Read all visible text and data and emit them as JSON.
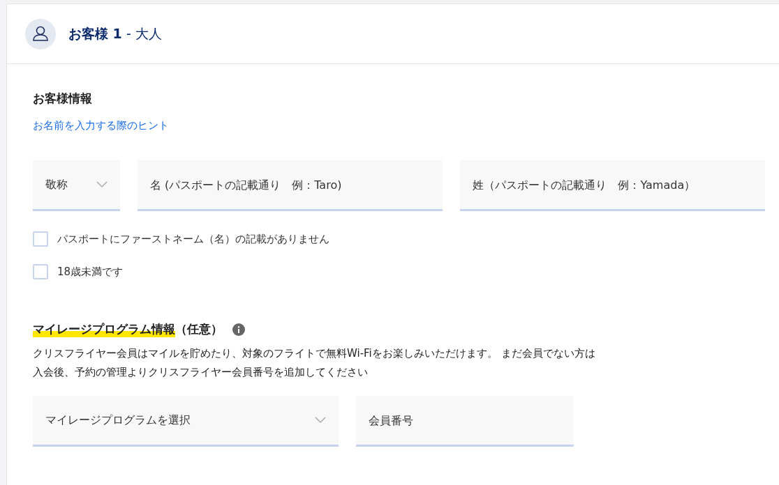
{
  "header": {
    "title": "**お客様 1** - 大人"
  },
  "customer_info": {
    "heading": "お客様情報",
    "hint_link": "お名前を入力する際のヒント",
    "fields": [
      {
        "kind": "select",
        "placeholder": "敬称"
      },
      {
        "kind": "input",
        "placeholder": "名 (パスポートの記載通り　例：Taro)"
      },
      {
        "kind": "input",
        "placeholder": "姓（パスポートの記載通り　例：Yamada）"
      }
    ],
    "checkboxes": [
      {
        "label": "パスポートにファーストネーム（名）の記載がありません",
        "checked": false
      },
      {
        "label": "18歳未満です",
        "checked": false
      }
    ]
  },
  "mileage": {
    "heading": "マイレージプログラム情報",
    "note": "（任意）",
    "description": [
      "クリスフライヤー会員はマイルを貯めたり、対象のフライトで無料Wi-Fiをお楽しみいただけます。 まだ会員でない方は",
      "入会後、予約の管理よりクリスフライヤー会員番号を追加してください"
    ],
    "fields": [
      {
        "kind": "select",
        "placeholder": "マイレージプログラムを選択"
      },
      {
        "kind": "input",
        "placeholder": "会員番号"
      }
    ]
  }
}
